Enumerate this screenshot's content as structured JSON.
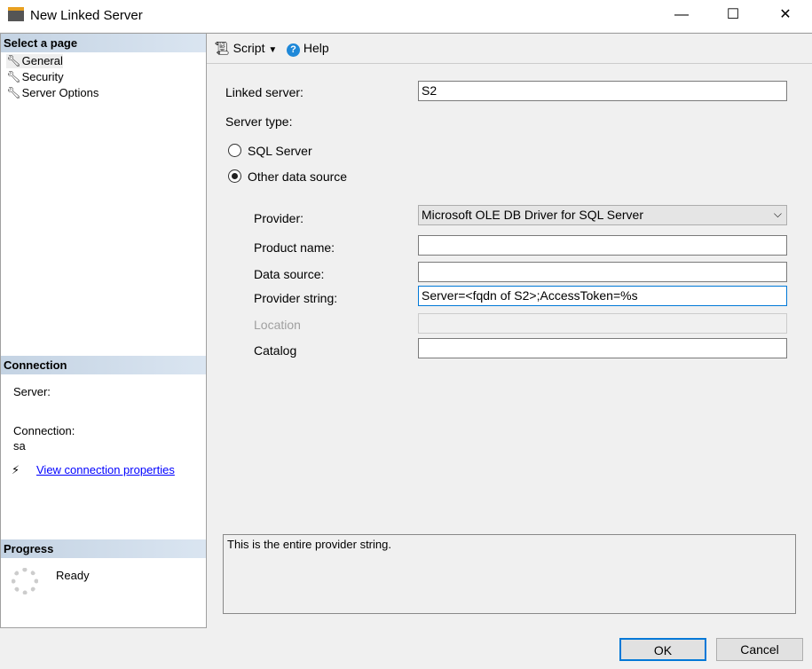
{
  "window": {
    "title": "New Linked Server",
    "minimize": "—",
    "maximize": "☐",
    "close": "✕"
  },
  "sidebar": {
    "select_header": "Select a page",
    "items": [
      {
        "label": "General"
      },
      {
        "label": "Security"
      },
      {
        "label": "Server Options"
      }
    ],
    "connection_header": "Connection",
    "server_label": "Server:",
    "server_value": "",
    "connection_label": "Connection:",
    "connection_value": "sa",
    "view_link": "View connection properties",
    "progress_header": "Progress",
    "progress_status": "Ready"
  },
  "toolbar": {
    "script": "Script",
    "help": "Help"
  },
  "form": {
    "linked_server_label": "Linked server:",
    "linked_server_value": "S2",
    "server_type_label": "Server type:",
    "radio_sql": "SQL Server",
    "radio_other": "Other data source",
    "selected": "Other data source",
    "provider_label": "Provider:",
    "provider_value": "Microsoft OLE DB Driver for SQL Server",
    "product_label": "Product name:",
    "product_value": "",
    "datasource_label": "Data source:",
    "datasource_value": "",
    "provstring_label": "Provider string:",
    "provstring_value": "Server=<fqdn of S2>;AccessToken=%s",
    "location_label": "Location",
    "location_value": "",
    "catalog_label": "Catalog",
    "catalog_value": ""
  },
  "description": "This is the entire provider string.",
  "buttons": {
    "ok": "OK",
    "cancel": "Cancel"
  }
}
